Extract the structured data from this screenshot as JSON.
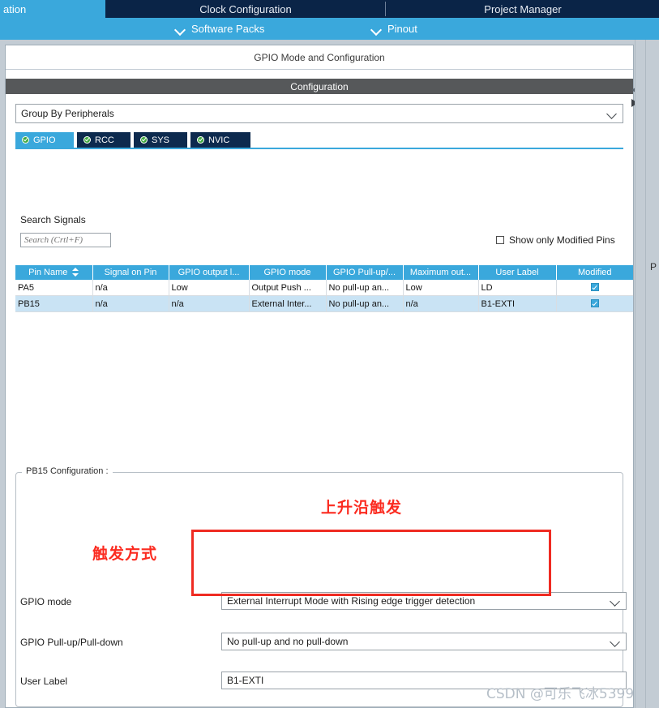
{
  "topbar": {
    "tabs": [
      {
        "label": "ation",
        "selected": true
      },
      {
        "label": "Clock Configuration",
        "selected": false
      },
      {
        "label": "Project Manager",
        "selected": false
      }
    ],
    "subtabs": [
      {
        "label": "Software Packs",
        "icon": "chevron-down-icon"
      },
      {
        "label": "Pinout",
        "icon": "chevron-down-icon"
      }
    ]
  },
  "panel": {
    "mode_header": "GPIO Mode and Configuration",
    "configuration_header": "Configuration",
    "group_by": {
      "value": "Group By Peripherals",
      "icon": "chevron-down-icon"
    },
    "peripheral_tabs": [
      {
        "label": "GPIO",
        "selected": true,
        "icon": "green-check-icon"
      },
      {
        "label": "RCC",
        "selected": false,
        "icon": "green-check-icon"
      },
      {
        "label": "SYS",
        "selected": false,
        "icon": "green-check-icon"
      },
      {
        "label": "NVIC",
        "selected": false,
        "icon": "green-check-icon"
      }
    ],
    "search": {
      "label": "Search Signals",
      "placeholder": "Search (Crtl+F)",
      "value": ""
    },
    "show_modified": {
      "label": "Show only Modified Pins",
      "checked": false
    },
    "edge_letter": "P"
  },
  "table": {
    "columns": [
      "Pin Name",
      "Signal on Pin",
      "GPIO output l...",
      "GPIO mode",
      "GPIO Pull-up/...",
      "Maximum out...",
      "User Label",
      "Modified"
    ],
    "rows": [
      {
        "pin_name": "PA5",
        "signal_on_pin": "n/a",
        "gpio_output": "Low",
        "gpio_mode": "Output Push ...",
        "gpio_pull": "No pull-up an...",
        "max_output": "Low",
        "user_label": "LD",
        "modified": true,
        "selected": false
      },
      {
        "pin_name": "PB15",
        "signal_on_pin": "n/a",
        "gpio_output": "n/a",
        "gpio_mode": "External Inter...",
        "gpio_pull": "No pull-up an...",
        "max_output": "n/a",
        "user_label": "B1-EXTI",
        "modified": true,
        "selected": true
      }
    ]
  },
  "pin_config": {
    "group_title": "PB15 Configuration :",
    "gpio_mode": {
      "label": "GPIO mode",
      "value": "External Interrupt Mode with Rising edge trigger detection",
      "icon": "chevron-down-icon"
    },
    "gpio_pull": {
      "label": "GPIO Pull-up/Pull-down",
      "value": "No pull-up and no pull-down",
      "icon": "chevron-down-icon"
    },
    "user_label": {
      "label": "User Label",
      "value": "B1-EXTI"
    }
  },
  "annotations": {
    "top_note": "上升沿触发",
    "left_note": "触发方式",
    "highlight_color": "#ef2b22"
  },
  "watermark": "CSDN @可乐飞冰5399"
}
